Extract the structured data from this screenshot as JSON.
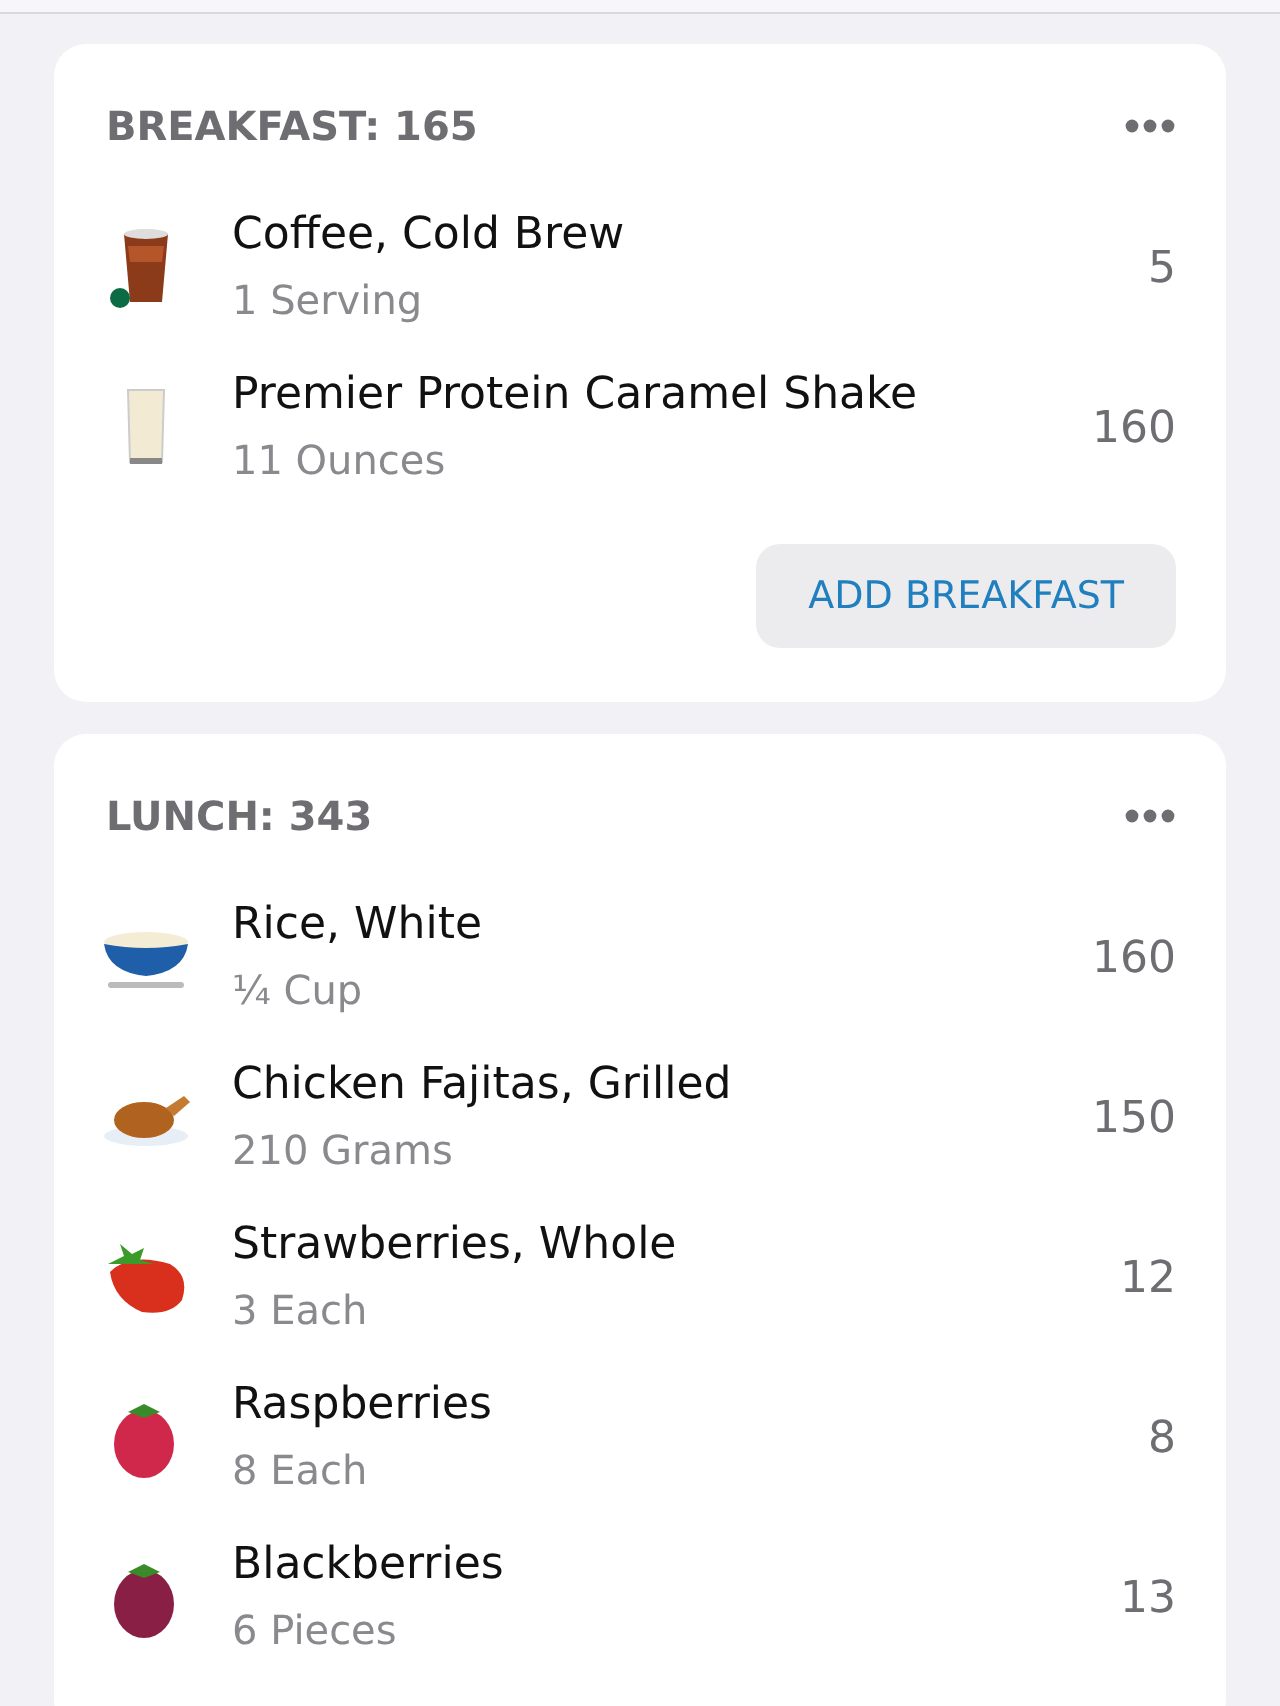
{
  "meals": [
    {
      "title": "BREAKFAST: 165",
      "items": [
        {
          "kind": "iced-coffee",
          "name": "Coffee, Cold Brew",
          "serving": "1 Serving",
          "calories": "5"
        },
        {
          "kind": "milk-glass",
          "name": "Premier Protein Caramel Shake",
          "serving": "11 Ounces",
          "calories": "160"
        }
      ],
      "button": "ADD BREAKFAST"
    },
    {
      "title": "LUNCH: 343",
      "items": [
        {
          "kind": "rice-bowl",
          "name": "Rice, White",
          "serving": "¼ Cup",
          "calories": "160"
        },
        {
          "kind": "roast-chicken",
          "name": "Chicken Fajitas, Grilled",
          "serving": "210 Grams",
          "calories": "150"
        },
        {
          "kind": "strawberry",
          "name": "Strawberries, Whole",
          "serving": "3 Each",
          "calories": "12"
        },
        {
          "kind": "raspberry",
          "name": "Raspberries",
          "serving": "8 Each",
          "calories": "8"
        },
        {
          "kind": "blackberry",
          "name": "Blackberries",
          "serving": "6 Pieces",
          "calories": "13"
        }
      ]
    }
  ]
}
